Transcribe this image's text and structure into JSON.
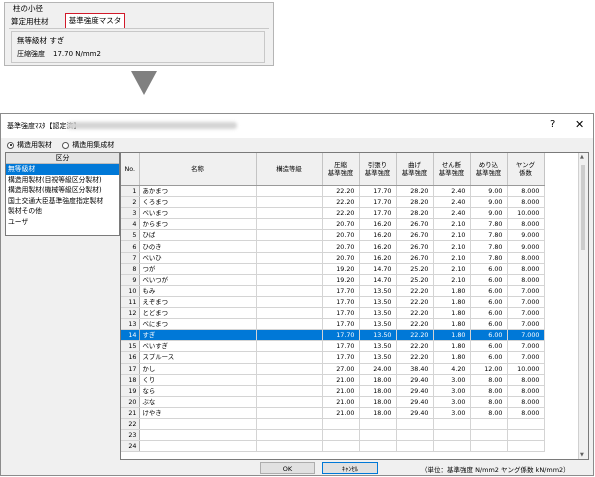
{
  "top_panel": {
    "group_title": "柱の小径",
    "tab_left": "算定用柱材",
    "tab_right": "基準強度マスタ",
    "material": "無等級材 すぎ",
    "strength_label": "圧縮強度",
    "strength_value": "17.70 N/mm2"
  },
  "dialog": {
    "title": "基準強度ﾏｽﾀ【認定済】",
    "help": "?",
    "close": "✕",
    "radio_sawn": "構造用製材",
    "radio_glulam": "構造用集成材",
    "category_header": "区分",
    "categories": [
      "無等級材",
      "構造用製材(目視等級区分製材)",
      "構造用製材(機械等級区分製材)",
      "国土交通大臣基準強度指定製材",
      "製材その他",
      "ユーザ"
    ],
    "columns": [
      "No.",
      "名称",
      "構造等級",
      "圧縮\n基準強度",
      "引張り\n基準強度",
      "曲げ\n基準強度",
      "せん断\n基準強度",
      "めり込\n基準強度",
      "ヤング\n係数"
    ],
    "rows": [
      [
        "1",
        "あかまつ",
        "",
        "22.20",
        "17.70",
        "28.20",
        "2.40",
        "9.00",
        "8.000"
      ],
      [
        "2",
        "くろまつ",
        "",
        "22.20",
        "17.70",
        "28.20",
        "2.40",
        "9.00",
        "8.000"
      ],
      [
        "3",
        "べいまつ",
        "",
        "22.20",
        "17.70",
        "28.20",
        "2.40",
        "9.00",
        "10.000"
      ],
      [
        "4",
        "からまつ",
        "",
        "20.70",
        "16.20",
        "26.70",
        "2.10",
        "7.80",
        "8.000"
      ],
      [
        "5",
        "ひば",
        "",
        "20.70",
        "16.20",
        "26.70",
        "2.10",
        "7.80",
        "9.000"
      ],
      [
        "6",
        "ひのき",
        "",
        "20.70",
        "16.20",
        "26.70",
        "2.10",
        "7.80",
        "9.000"
      ],
      [
        "7",
        "べいひ",
        "",
        "20.70",
        "16.20",
        "26.70",
        "2.10",
        "7.80",
        "8.000"
      ],
      [
        "8",
        "つが",
        "",
        "19.20",
        "14.70",
        "25.20",
        "2.10",
        "6.00",
        "8.000"
      ],
      [
        "9",
        "べいつが",
        "",
        "19.20",
        "14.70",
        "25.20",
        "2.10",
        "6.00",
        "8.000"
      ],
      [
        "10",
        "もみ",
        "",
        "17.70",
        "13.50",
        "22.20",
        "1.80",
        "6.00",
        "7.000"
      ],
      [
        "11",
        "えぞまつ",
        "",
        "17.70",
        "13.50",
        "22.20",
        "1.80",
        "6.00",
        "7.000"
      ],
      [
        "12",
        "とどまつ",
        "",
        "17.70",
        "13.50",
        "22.20",
        "1.80",
        "6.00",
        "7.000"
      ],
      [
        "13",
        "べにまつ",
        "",
        "17.70",
        "13.50",
        "22.20",
        "1.80",
        "6.00",
        "7.000"
      ],
      [
        "14",
        "すぎ",
        "",
        "17.70",
        "13.50",
        "22.20",
        "1.80",
        "6.00",
        "7.000"
      ],
      [
        "15",
        "べいすぎ",
        "",
        "17.70",
        "13.50",
        "22.20",
        "1.80",
        "6.00",
        "7.000"
      ],
      [
        "16",
        "スプルース",
        "",
        "17.70",
        "13.50",
        "22.20",
        "1.80",
        "6.00",
        "7.000"
      ],
      [
        "17",
        "かし",
        "",
        "27.00",
        "24.00",
        "38.40",
        "4.20",
        "12.00",
        "10.000"
      ],
      [
        "18",
        "くり",
        "",
        "21.00",
        "18.00",
        "29.40",
        "3.00",
        "8.00",
        "8.000"
      ],
      [
        "19",
        "なら",
        "",
        "21.00",
        "18.00",
        "29.40",
        "3.00",
        "8.00",
        "8.000"
      ],
      [
        "20",
        "ぶな",
        "",
        "21.00",
        "18.00",
        "29.40",
        "3.00",
        "8.00",
        "8.000"
      ],
      [
        "21",
        "けやき",
        "",
        "21.00",
        "18.00",
        "29.40",
        "3.00",
        "8.00",
        "8.000"
      ],
      [
        "22",
        "",
        "",
        "",
        "",
        "",
        "",
        "",
        ""
      ],
      [
        "23",
        "",
        "",
        "",
        "",
        "",
        "",
        "",
        ""
      ],
      [
        "24",
        "",
        "",
        "",
        "",
        "",
        "",
        "",
        ""
      ]
    ],
    "selected_row": 13,
    "ok": "OK",
    "cancel": "ｷｬﾝｾﾙ",
    "unit_note": "（単位：基準強度 N/mm2  ヤング係数 kN/mm2）"
  }
}
